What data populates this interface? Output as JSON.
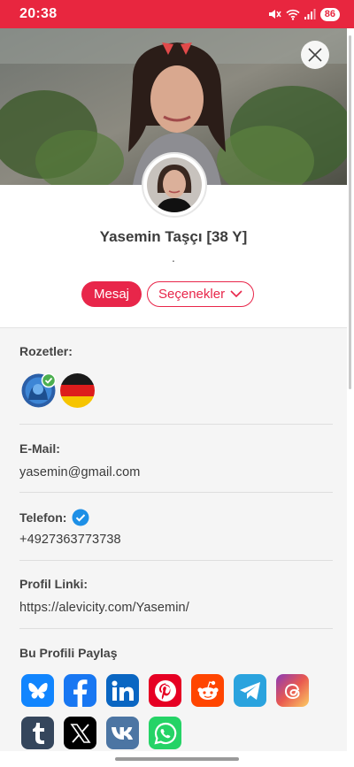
{
  "status_bar": {
    "time": "20:38",
    "battery": "86"
  },
  "profile": {
    "name": "Yasemin Taşçı [38 Y]",
    "subtitle": "."
  },
  "actions": {
    "message": "Mesaj",
    "options": "Seçenekler"
  },
  "badges": {
    "label": "Rozetler:",
    "items": [
      "verified-community-badge",
      "germany-flag-badge"
    ]
  },
  "email": {
    "label": "E-Mail:",
    "value": "yasemin@gmail.com"
  },
  "phone": {
    "label": "Telefon:",
    "value": "+4927363773738"
  },
  "profile_link": {
    "label": "Profil Linki:",
    "value": "https://alevicity.com/Yasemin/"
  },
  "share": {
    "label": "Bu Profili Paylaş",
    "networks": [
      "Bluesky",
      "Facebook",
      "LinkedIn",
      "Pinterest",
      "Reddit",
      "Telegram",
      "Threads",
      "Tumblr",
      "X",
      "VK",
      "WhatsApp"
    ]
  },
  "colors": {
    "accent": "#e8264a",
    "status_bar": "#e8263f",
    "verified": "#1d8fe6"
  }
}
